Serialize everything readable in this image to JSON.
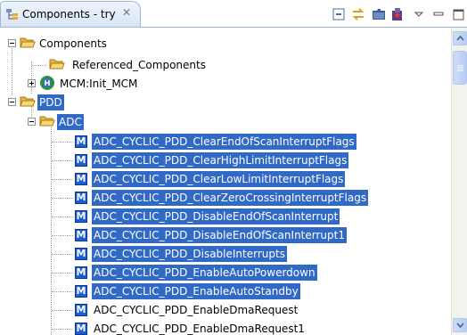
{
  "view": {
    "title": "Components - try",
    "close_glyph": "✕",
    "tab_icon": "component-tree-icon",
    "toolbar": [
      {
        "name": "collapse-all-button",
        "icon": "collapse-all-icon"
      },
      {
        "name": "link-with-editor-button",
        "icon": "link-arrows-icon"
      },
      {
        "name": "new-folder-button",
        "icon": "folder-icon"
      },
      {
        "name": "add-component-button",
        "icon": "component-add-icon"
      },
      {
        "name": "view-menu-button",
        "icon": "chevron-down-icon"
      },
      {
        "name": "minimize-button",
        "icon": "minimize-icon"
      },
      {
        "name": "maximize-button",
        "icon": "maximize-icon"
      }
    ]
  },
  "tree": {
    "components": "Components",
    "referenced": "Referenced_Components",
    "mcm": "MCM:Init_MCM",
    "pdd": "PDD",
    "adc": "ADC",
    "methods": [
      {
        "label": "ADC_CYCLIC_PDD_ClearEndOfScanInterruptFlags",
        "selected": true
      },
      {
        "label": "ADC_CYCLIC_PDD_ClearHighLimitInterruptFlags",
        "selected": true
      },
      {
        "label": "ADC_CYCLIC_PDD_ClearLowLimitInterruptFlags",
        "selected": true
      },
      {
        "label": "ADC_CYCLIC_PDD_ClearZeroCrossingInterruptFlags",
        "selected": true
      },
      {
        "label": "ADC_CYCLIC_PDD_DisableEndOfScanInterrupt",
        "selected": true
      },
      {
        "label": "ADC_CYCLIC_PDD_DisableEndOfScanInterrupt1",
        "selected": true
      },
      {
        "label": "ADC_CYCLIC_PDD_DisableInterrupts",
        "selected": true
      },
      {
        "label": "ADC_CYCLIC_PDD_EnableAutoPowerdown",
        "selected": true
      },
      {
        "label": "ADC_CYCLIC_PDD_EnableAutoStandby",
        "selected": true
      },
      {
        "label": "ADC_CYCLIC_PDD_EnableDmaRequest",
        "selected": false
      },
      {
        "label": "ADC_CYCLIC_PDD_EnableDmaRequest1",
        "selected": false
      }
    ],
    "method_icon_letter": "M"
  },
  "colors": {
    "selection": "#3169c6",
    "folder": "#f5c24c",
    "method_icon": "#1a5fd1"
  }
}
